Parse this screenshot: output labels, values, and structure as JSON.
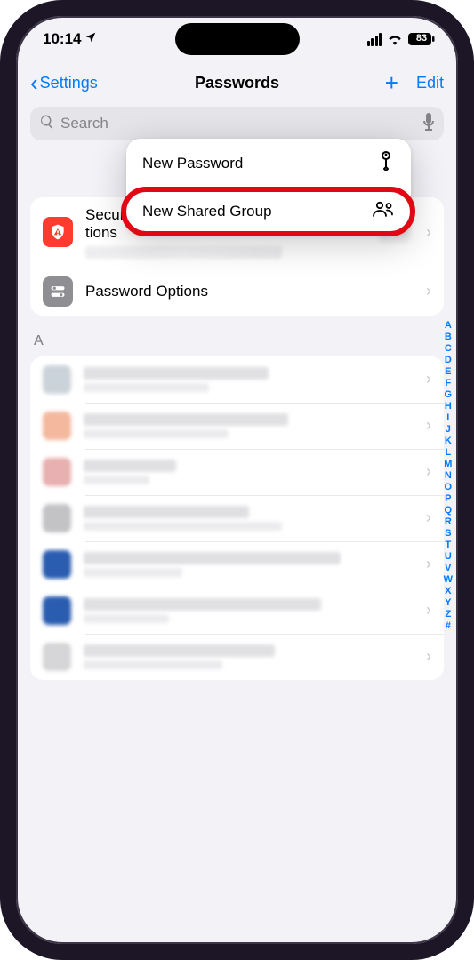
{
  "status": {
    "time": "10:14",
    "battery_pct": "83"
  },
  "nav": {
    "back": "Settings",
    "title": "Passwords",
    "edit": "Edit"
  },
  "search": {
    "placeholder": "Search"
  },
  "menu": {
    "new_password": "New Password",
    "new_shared_group": "New Shared Group"
  },
  "sections": {
    "recommendations": {
      "title": "Security Recommendations"
    },
    "options": {
      "title": "Password Options"
    }
  },
  "section_letter": "A",
  "index_letters": [
    "A",
    "B",
    "C",
    "D",
    "E",
    "F",
    "G",
    "H",
    "I",
    "J",
    "K",
    "L",
    "M",
    "N",
    "O",
    "P",
    "Q",
    "R",
    "S",
    "T",
    "U",
    "V",
    "W",
    "X",
    "Y",
    "Z",
    "#"
  ]
}
